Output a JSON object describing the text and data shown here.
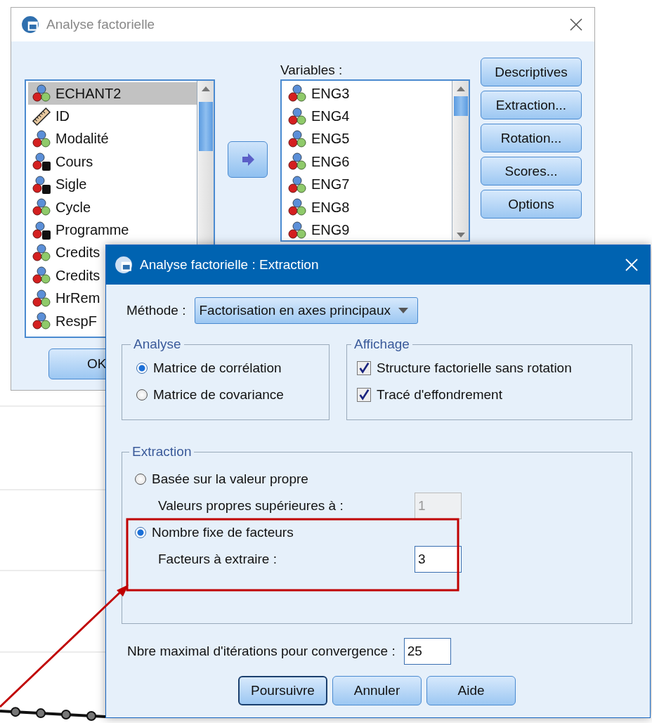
{
  "back_window": {
    "title": "Analyse factorielle",
    "source_list": [
      {
        "name": "ECHANT2",
        "kind": "nominal",
        "selected": true
      },
      {
        "name": "ID",
        "kind": "scale",
        "selected": false
      },
      {
        "name": "Modalité",
        "kind": "nominal",
        "selected": false
      },
      {
        "name": "Cours",
        "kind": "string",
        "selected": false
      },
      {
        "name": "Sigle",
        "kind": "string",
        "selected": false
      },
      {
        "name": "Cycle",
        "kind": "nominal",
        "selected": false
      },
      {
        "name": "Programme",
        "kind": "string",
        "selected": false
      },
      {
        "name": "Credits",
        "kind": "nominal",
        "selected": false
      },
      {
        "name": "Credits",
        "kind": "nominal",
        "selected": false
      },
      {
        "name": "HrRem",
        "kind": "nominal",
        "selected": false
      },
      {
        "name": "RespF",
        "kind": "nominal",
        "selected": false
      }
    ],
    "variables_label": "Variables :",
    "variables": [
      {
        "name": "ENG3",
        "kind": "nominal"
      },
      {
        "name": "ENG4",
        "kind": "nominal"
      },
      {
        "name": "ENG5",
        "kind": "nominal"
      },
      {
        "name": "ENG6",
        "kind": "nominal"
      },
      {
        "name": "ENG7",
        "kind": "nominal"
      },
      {
        "name": "ENG8",
        "kind": "nominal"
      },
      {
        "name": "ENG9",
        "kind": "nominal"
      }
    ],
    "buttons": [
      "Descriptives",
      "Extraction...",
      "Rotation...",
      "Scores...",
      "Options"
    ],
    "ok_button": "OK"
  },
  "front_window": {
    "title": "Analyse factorielle : Extraction",
    "method_label": "Méthode :",
    "method_value": "Factorisation en axes principaux",
    "analysis": {
      "title": "Analyse",
      "options": [
        {
          "label": "Matrice de corrélation",
          "selected": true
        },
        {
          "label": "Matrice de covariance",
          "selected": false
        }
      ]
    },
    "display": {
      "title": "Affichage",
      "options": [
        {
          "label": "Structure factorielle sans rotation",
          "checked": true
        },
        {
          "label": "Tracé d'effondrement",
          "checked": true
        }
      ]
    },
    "extraction": {
      "title": "Extraction",
      "options": [
        {
          "label": "Basée sur la valeur propre",
          "selected": false,
          "field_label": "Valeurs propres supérieures à :",
          "field_value": "1",
          "disabled": true
        },
        {
          "label": "Nombre fixe de facteurs",
          "selected": true,
          "field_label": "Facteurs à extraire :",
          "field_value": "3",
          "disabled": false
        }
      ]
    },
    "iterations_label": "Nbre maximal d'itérations pour convergence :",
    "iterations_value": "25",
    "buttons": [
      {
        "label": "Poursuivre",
        "default": true
      },
      {
        "label": "Annuler",
        "default": false
      },
      {
        "label": "Aide",
        "default": false
      }
    ]
  }
}
